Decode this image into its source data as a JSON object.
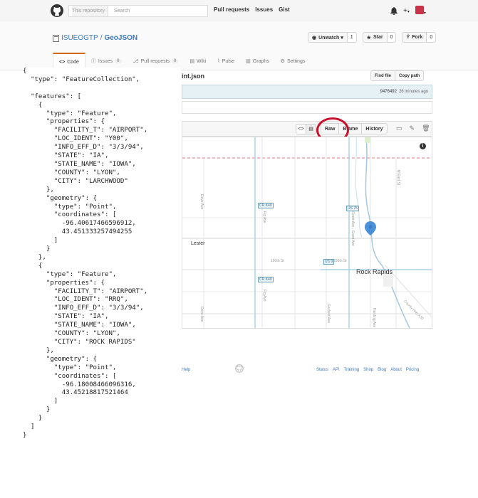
{
  "header": {
    "search_scope": "This repository",
    "search_placeholder": "Search",
    "nav": [
      "Pull requests",
      "Issues",
      "Gist"
    ],
    "plus_label": "+",
    "caret": "▾"
  },
  "repo": {
    "owner": "ISUEOGTP",
    "separator": " / ",
    "name": "GeoJSON",
    "unwatch_label": "Unwatch ▾",
    "unwatch_count": "1",
    "star_label": "Star",
    "star_count": "0",
    "fork_label": "Fork",
    "fork_count": "0",
    "tabs": [
      {
        "label": "Code",
        "count": ""
      },
      {
        "label": "Issues",
        "count": "0"
      },
      {
        "label": "Pull requests",
        "count": "0"
      },
      {
        "label": "Wiki",
        "count": ""
      },
      {
        "label": "Pulse",
        "count": ""
      },
      {
        "label": "Graphs",
        "count": ""
      },
      {
        "label": "Settings",
        "count": ""
      }
    ]
  },
  "file": {
    "name_fragment": "int.json",
    "find_file": "Find file",
    "copy_path": "Copy path",
    "commit_sha": "9476492",
    "commit_time": "26 minutes ago",
    "raw": "Raw",
    "blame": "Blame",
    "history": "History"
  },
  "map": {
    "labels": {
      "lester": "Lester",
      "rock_rapids": "Rock Rapids",
      "st150": "150th St",
      "st150b": "150th St",
      "dove": "Dove Ave",
      "dove2": "Dove Ave",
      "fig": "Fig Ave",
      "fig2": "Fig Ave",
      "garfield": "Garfield Ave",
      "grant": "Grant Ave - Grant Ave",
      "harding": "Harding Ave",
      "eastst": "N East St",
      "county": "County Hwy A30"
    },
    "shields": {
      "cr1": "CR K40",
      "cr2": "CR K40",
      "us1": "US 75",
      "us2": "US 9"
    }
  },
  "footer": {
    "help": "Help",
    "links": [
      "Status",
      "API",
      "Training",
      "Shop",
      "Blog",
      "About",
      "Pricing"
    ]
  },
  "geojson_text": "{\n  \"type\": \"FeatureCollection\",\n\n  \"features\": [\n    {\n      \"type\": \"Feature\",\n      \"properties\": {\n        \"FACILITY_T\": \"AIRPORT\",\n        \"LOC_IDENT\": \"Y00\",\n        \"INFO_EFF_D\": \"3/3/94\",\n        \"STATE\": \"IA\",\n        \"STATE_NAME\": \"IOWA\",\n        \"COUNTY\": \"LYON\",\n        \"CITY\": \"LARCHWOOD\"\n      },\n      \"geometry\": {\n        \"type\": \"Point\",\n        \"coordinates\": [\n          -96.40617466596912,\n          43.451333257494255\n        ]\n      }\n    },\n    {\n      \"type\": \"Feature\",\n      \"properties\": {\n        \"FACILITY_T\": \"AIRPORT\",\n        \"LOC_IDENT\": \"RRQ\",\n        \"INFO_EFF_D\": \"3/3/94\",\n        \"STATE\": \"IA\",\n        \"STATE_NAME\": \"IOWA\",\n        \"COUNTY\": \"LYON\",\n        \"CITY\": \"ROCK RAPIDS\"\n      },\n      \"geometry\": {\n        \"type\": \"Point\",\n        \"coordinates\": [\n          -96.18008466096316,\n          43.45218817521464\n        ]\n      }\n    }\n  ]\n}",
  "colors": {
    "link": "#4078c0",
    "tab_accent": "#d26911",
    "highlight_circle": "#c8102e",
    "marker": "#4a90d9"
  }
}
